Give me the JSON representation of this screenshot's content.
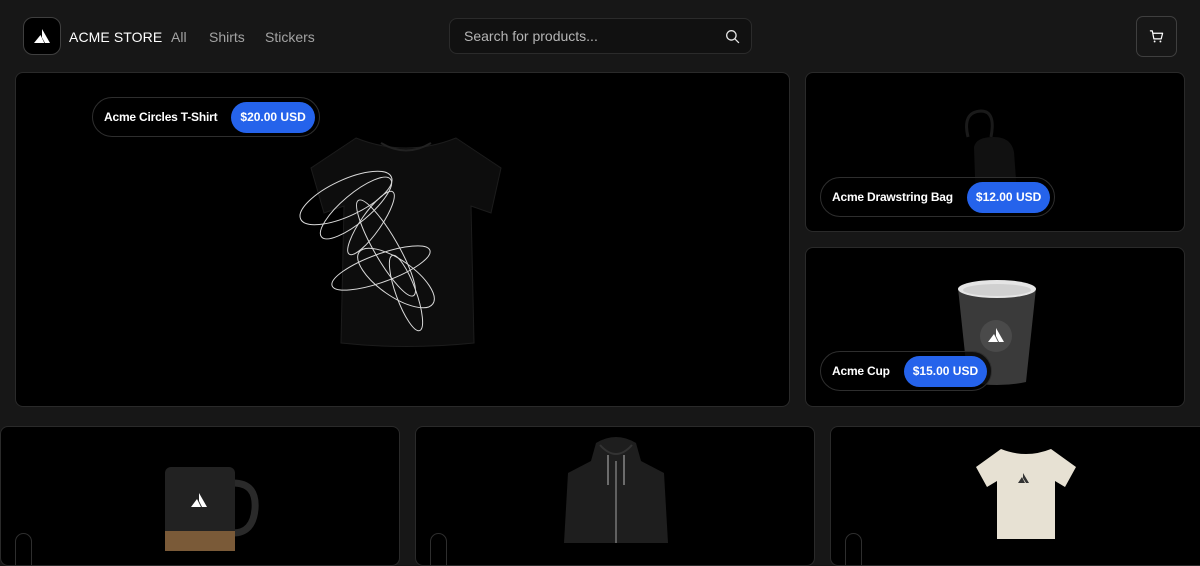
{
  "header": {
    "store_name": "ACME STORE",
    "nav": [
      "All",
      "Shirts",
      "Stickers"
    ],
    "search_placeholder": "Search for products...",
    "icons": {
      "logo": "acme-triangle-icon",
      "search": "search-icon",
      "cart": "cart-icon"
    }
  },
  "products": {
    "featured": {
      "name": "Acme Circles T-Shirt",
      "price": "$20.00 USD"
    },
    "side_top": {
      "name": "Acme Drawstring Bag",
      "price": "$12.00 USD"
    },
    "side_bottom": {
      "name": "Acme Cup",
      "price": "$15.00 USD"
    }
  },
  "colors": {
    "background": "#171717",
    "tile": "#000000",
    "price_pill": "#2563eb"
  }
}
